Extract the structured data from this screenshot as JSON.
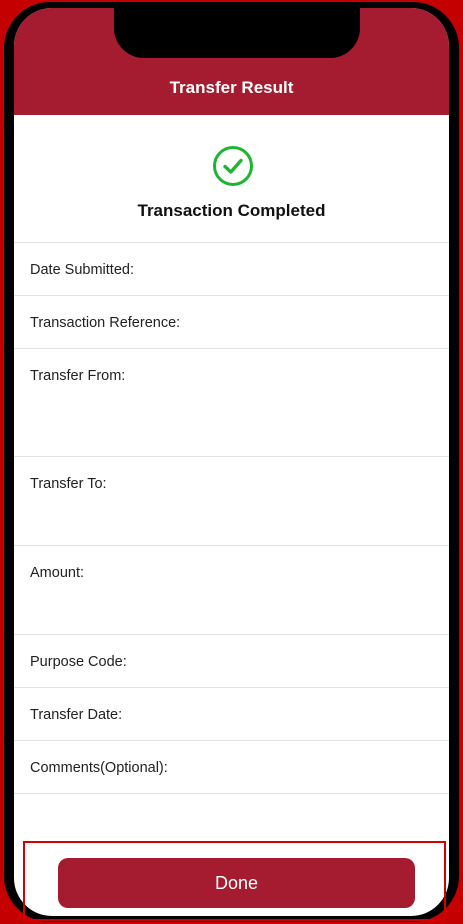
{
  "header": {
    "title": "Transfer Result"
  },
  "status": {
    "icon": "check-circle-icon",
    "title": "Transaction Completed",
    "color": "#1db531"
  },
  "fields": [
    {
      "label": "Date Submitted:"
    },
    {
      "label": "Transaction Reference:"
    },
    {
      "label": "Transfer From:"
    },
    {
      "label": "Transfer To:"
    },
    {
      "label": "Amount:"
    },
    {
      "label": "Purpose Code:"
    },
    {
      "label": "Transfer Date:"
    },
    {
      "label": "Comments(Optional):"
    }
  ],
  "footer": {
    "done_label": "Done"
  },
  "colors": {
    "brand": "#a51c30",
    "highlight": "#d20000"
  }
}
